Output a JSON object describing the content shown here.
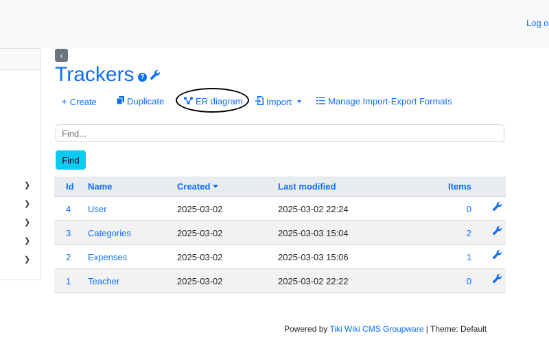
{
  "header": {
    "logout_label": "Log out"
  },
  "page": {
    "title": "Trackers",
    "help_icon": "question-circle-icon",
    "admin_icon": "wrench-icon",
    "back_icon": "chevron-left-icon"
  },
  "toolbar": {
    "create_label": "Create",
    "duplicate_label": "Duplicate",
    "er_diagram_label": "ER diagram",
    "import_label": "Import",
    "manage_label": "Manage Import-Export Formats"
  },
  "search": {
    "placeholder": "Find...",
    "value": "",
    "button_label": "Find"
  },
  "table": {
    "headers": {
      "id": "Id",
      "name": "Name",
      "created": "Created",
      "last_modified": "Last modified",
      "items": "Items"
    },
    "rows": [
      {
        "id": "4",
        "name": "User",
        "created": "2025-03-02",
        "last_modified": "2025-03-02 22:24",
        "items": "0"
      },
      {
        "id": "3",
        "name": "Categories",
        "created": "2025-03-02",
        "last_modified": "2025-03-03 15:04",
        "items": "2"
      },
      {
        "id": "2",
        "name": "Expenses",
        "created": "2025-03-02",
        "last_modified": "2025-03-03 15:06",
        "items": "1"
      },
      {
        "id": "1",
        "name": "Teacher",
        "created": "2025-03-02",
        "last_modified": "2025-03-02 22:22",
        "items": "0"
      }
    ]
  },
  "footer": {
    "powered_by": "Powered by",
    "product": "Tiki Wiki CMS Groupware",
    "theme": "| Theme: Default"
  },
  "colors": {
    "accent": "#0d6efd",
    "find_button": "#0dcaf0",
    "back_button": "#6c757d"
  }
}
